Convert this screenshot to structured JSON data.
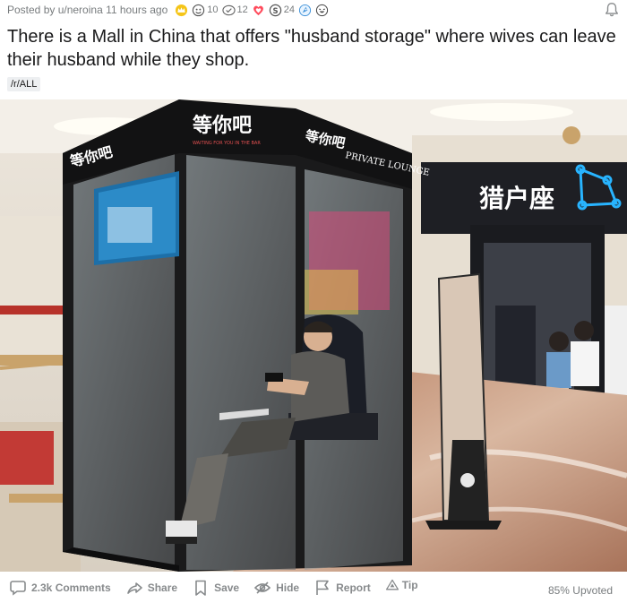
{
  "post": {
    "posted_by": "Posted by u/neroina 11 hours ago",
    "awards": [
      {
        "icon": "gold-crown-icon",
        "count": ""
      },
      {
        "icon": "wholesome-award-icon",
        "count": "10"
      },
      {
        "icon": "helpful-award-icon",
        "count": "12"
      },
      {
        "icon": "heart-award-icon",
        "count": ""
      },
      {
        "icon": "silver-coin-icon",
        "count": "24"
      },
      {
        "icon": "rocket-award-icon",
        "count": ""
      },
      {
        "icon": "laughing-award-icon",
        "count": ""
      }
    ],
    "title": "There is a Mall in China that offers \"husband storage\" where wives can leave their husband while they shop.",
    "flair": "/r/ALL"
  },
  "photo": {
    "booth_sign_left": "等你吧",
    "booth_sign_center": "等你吧",
    "booth_sign_right": "等你吧",
    "booth_sign_text": "PRIVATE LOUNGE",
    "booth_sign_sub": "WAITING FOR YOU IN THE BAR",
    "store_sign": "猎户座"
  },
  "footer": {
    "comments": "2.3k Comments",
    "share": "Share",
    "save": "Save",
    "hide": "Hide",
    "report": "Report",
    "tip": "Tip",
    "upvoted": "85% Upvoted"
  }
}
